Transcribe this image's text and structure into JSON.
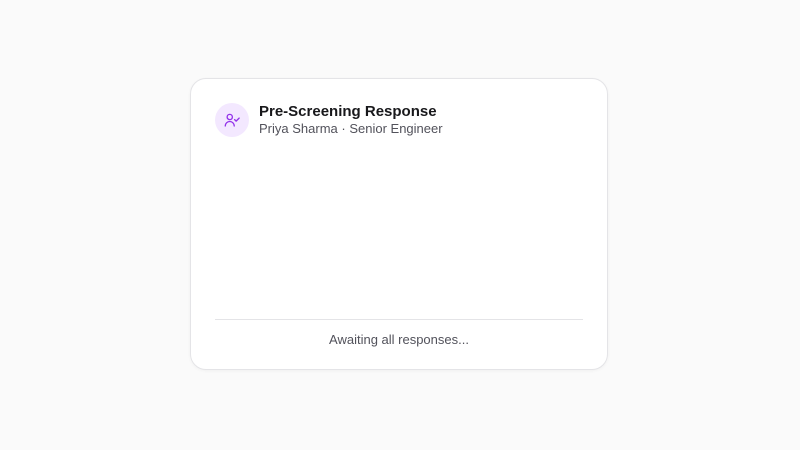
{
  "card": {
    "title": "Pre-Screening Response",
    "candidate_name": "Priya Sharma",
    "separator": "·",
    "role": "Senior Engineer",
    "status_text": "Awaiting all responses...",
    "icon": "user-check-icon",
    "accent_color": "#9333ea",
    "accent_bg": "#f3e8ff"
  }
}
